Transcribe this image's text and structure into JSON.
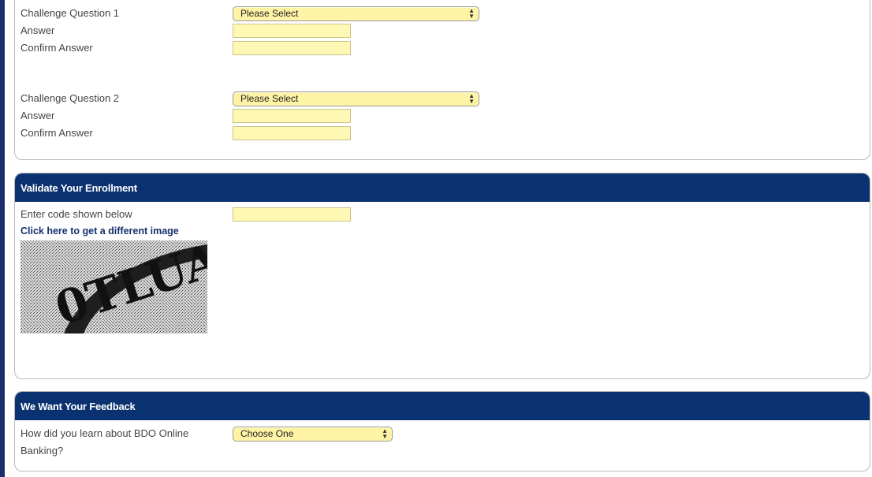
{
  "questions": [
    {
      "question_label": "Challenge Question 1",
      "select_value": "Please Select",
      "answer_label": "Answer",
      "confirm_label": "Confirm Answer"
    },
    {
      "question_label": "Challenge Question 2",
      "select_value": "Please Select",
      "answer_label": "Answer",
      "confirm_label": "Confirm Answer"
    }
  ],
  "validate": {
    "header": "Validate Your Enrollment",
    "code_label": "Enter code shown below",
    "different_image_link": "Click here to get a different image",
    "captcha_text": "0TLUA"
  },
  "feedback": {
    "header": "We Want Your Feedback",
    "question_label": "How did you learn about BDO Online Banking?",
    "select_value": "Choose One"
  },
  "colors": {
    "header_bg": "#0a3270",
    "field_bg": "#fff8b5",
    "left_bar": "#1c2f6b",
    "link": "#13316d"
  }
}
